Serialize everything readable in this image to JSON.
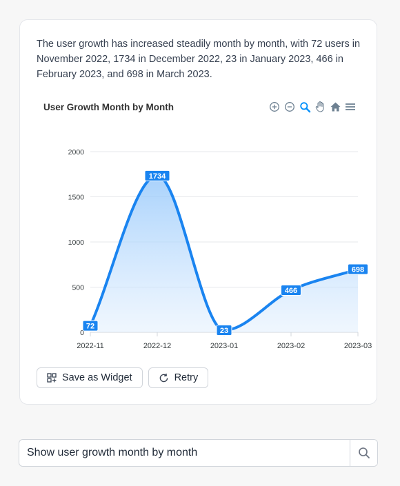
{
  "message": {
    "summary": "The user growth has increased steadily month by month, with 72 users in November 2022, 1734 in December 2022, 23 in January 2023, 466 in February 2023, and 698 in March 2023."
  },
  "chart_toolbar": {
    "icons": [
      "zoom-in-icon",
      "zoom-out-icon",
      "selection-zoom-icon",
      "pan-icon",
      "home-icon",
      "menu-icon"
    ],
    "active_color": "#008ffb",
    "inactive_color": "#6e8192"
  },
  "chart_data": {
    "type": "area",
    "title": "User Growth Month by Month",
    "categories": [
      "2022-11",
      "2022-12",
      "2023-01",
      "2023-02",
      "2023-03"
    ],
    "series": [
      {
        "values": [
          72,
          1734,
          23,
          466,
          698
        ]
      }
    ],
    "ylim": [
      0,
      2000
    ],
    "yticks": [
      0,
      500,
      1000,
      1500,
      2000
    ],
    "grid": true,
    "curve": "smooth",
    "data_labels": true,
    "colors": {
      "line": "#1a84f0",
      "fill_top": "#8cc3fb",
      "fill_bottom": "#e3f0fe",
      "label_bg": "#1a84f0"
    }
  },
  "actions": {
    "save_widget_label": "Save as Widget",
    "retry_label": "Retry"
  },
  "search": {
    "value": "Show user growth month by month"
  }
}
